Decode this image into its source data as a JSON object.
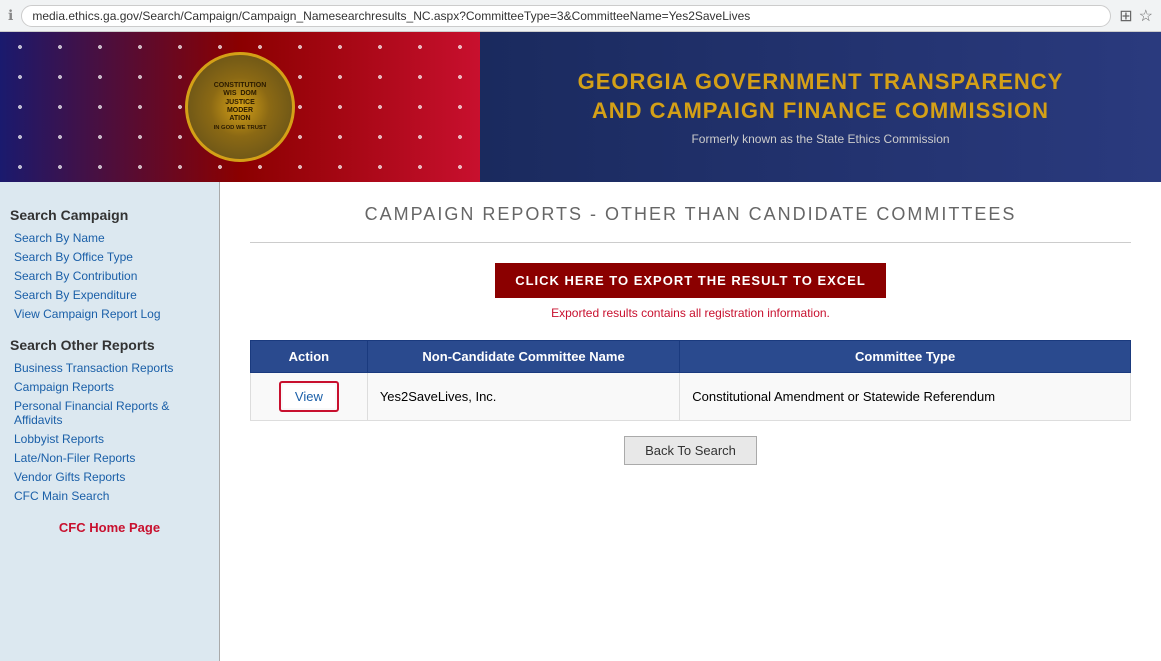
{
  "browser": {
    "url": "media.ethics.ga.gov/Search/Campaign/Campaign_Namesearchresults_NC.aspx?CommitteeType=3&CommitteeName=Yes2SaveLives"
  },
  "header": {
    "title_line1": "GEORGIA GOVERNMENT TRANSPARENCY",
    "title_line2": "AND CAMPAIGN FINANCE COMMISSION",
    "subtitle": "Formerly known as the State Ethics Commission",
    "seal_text": "CONSTITUTION\nWIS\nDOM\nJUSTICE\nMODER\nATION\nIN GOD WE TRUST"
  },
  "sidebar": {
    "search_campaign_title": "Search Campaign",
    "links_campaign": [
      {
        "label": "Search By Name"
      },
      {
        "label": "Search By Office Type"
      },
      {
        "label": "Search By Contribution"
      },
      {
        "label": "Search By Expenditure"
      },
      {
        "label": "View Campaign Report Log"
      }
    ],
    "search_other_title": "Search Other Reports",
    "links_other": [
      {
        "label": "Business Transaction Reports"
      },
      {
        "label": "Campaign Reports"
      },
      {
        "label": "Personal Financial Reports & Affidavits"
      },
      {
        "label": "Lobbyist Reports"
      },
      {
        "label": "Late/Non-Filer Reports"
      },
      {
        "label": "Vendor Gifts Reports"
      },
      {
        "label": "CFC Main Search"
      }
    ],
    "cfc_home": "CFC Home Page"
  },
  "main": {
    "heading": "CAMPAIGN REPORTS - OTHER THAN CANDIDATE COMMITTEES",
    "export_button": "CLICK HERE TO EXPORT THE RESULT TO EXCEL",
    "export_note": "Exported results contains all registration information.",
    "table": {
      "headers": [
        "Action",
        "Non-Candidate Committee Name",
        "Committee Type"
      ],
      "rows": [
        {
          "action": "View",
          "name": "Yes2SaveLives, Inc.",
          "committee_type": "Constitutional Amendment or Statewide Referendum"
        }
      ]
    },
    "back_button": "Back To Search"
  }
}
